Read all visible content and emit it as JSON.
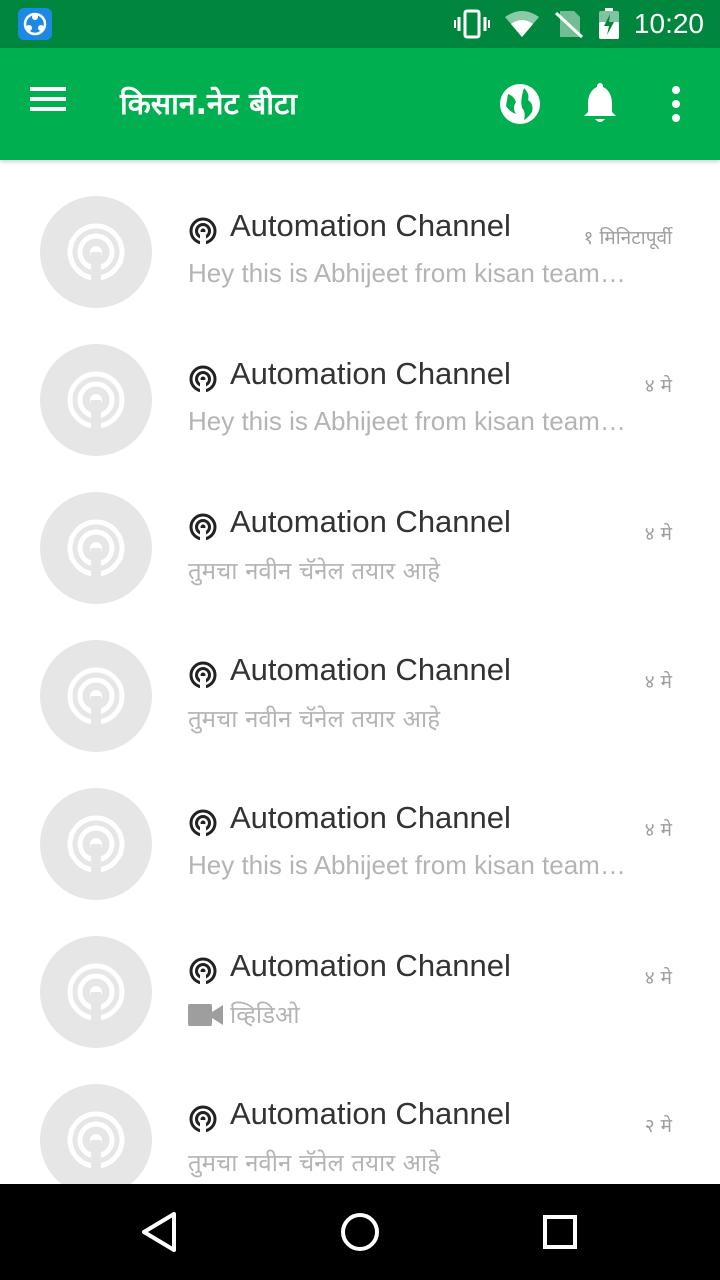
{
  "status_bar": {
    "time": "10:20",
    "icons": [
      "share-app-icon",
      "vibrate-icon",
      "wifi-icon",
      "no-sim-icon",
      "battery-charging-icon"
    ]
  },
  "app_bar": {
    "title": "किसान.नेट बीटा",
    "icons": [
      "menu-icon",
      "globe-icon",
      "bell-icon",
      "more-vert-icon"
    ],
    "color": "#00b050"
  },
  "channels": [
    {
      "name": "Automation Channel",
      "time": "१ मिनिटापूर्वी",
      "message": "Hey this is Abhijeet from kisan team. We are doing automation testing.",
      "type": "text"
    },
    {
      "name": "Automation Channel",
      "time": "४ मे",
      "message": "Hey this is Abhijeet from kisan team. We are doing automation testing.",
      "type": "text"
    },
    {
      "name": "Automation Channel",
      "time": "४ मे",
      "message": "तुमचा नवीन चॅनेल तयार आहे",
      "type": "text"
    },
    {
      "name": "Automation Channel",
      "time": "४ मे",
      "message": "तुमचा नवीन चॅनेल तयार आहे",
      "type": "text"
    },
    {
      "name": "Automation Channel",
      "time": "४ मे",
      "message": "Hey this is Abhijeet from kisan team. We are doing automation testing.",
      "type": "text"
    },
    {
      "name": "Automation Channel",
      "time": "४ मे",
      "message": "व्हिडिओ",
      "type": "video"
    },
    {
      "name": "Automation Channel",
      "time": "२ मे",
      "message": "तुमचा नवीन चॅनेल तयार आहे",
      "type": "text"
    }
  ],
  "nav_bar": {
    "icons": [
      "back-icon",
      "home-icon",
      "recent-apps-icon"
    ]
  }
}
